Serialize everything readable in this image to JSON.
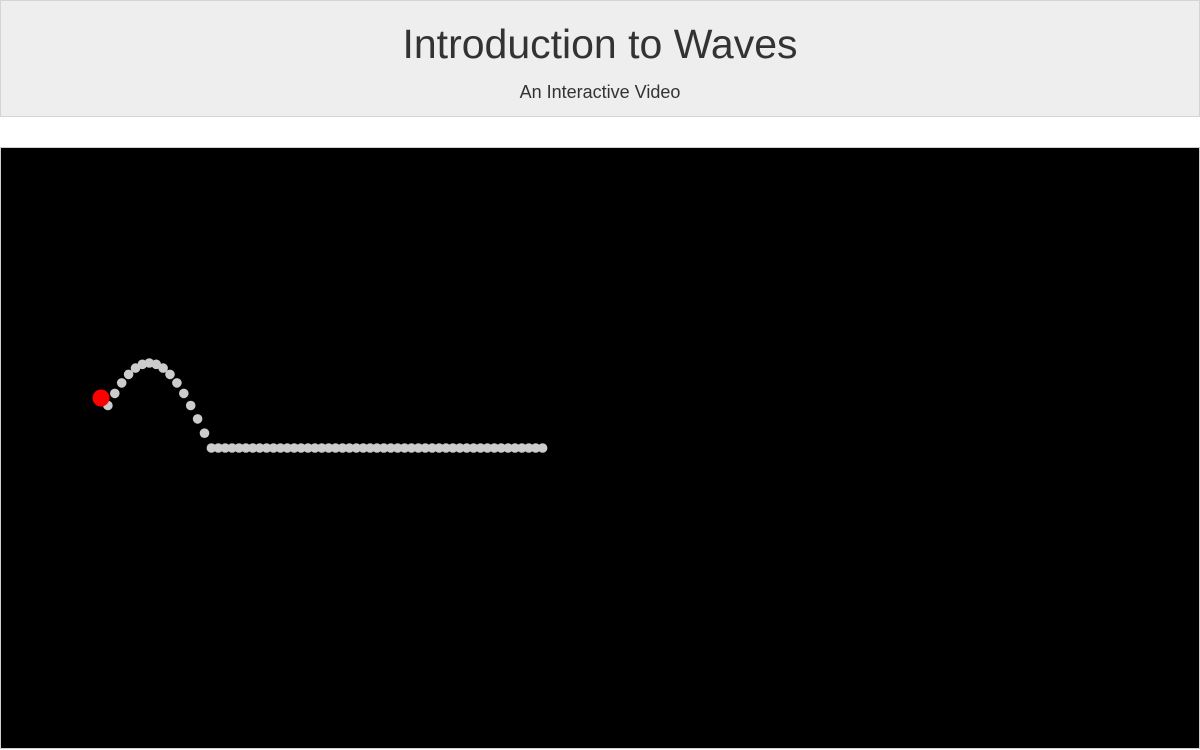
{
  "header": {
    "title": "Introduction to Waves",
    "subtitle": "An Interactive Video"
  },
  "simulation": {
    "background_color": "#000000",
    "bead_color": "#cccccc",
    "driver_color": "#ff0000",
    "bead_count": 65,
    "driver_phase": "rising"
  }
}
